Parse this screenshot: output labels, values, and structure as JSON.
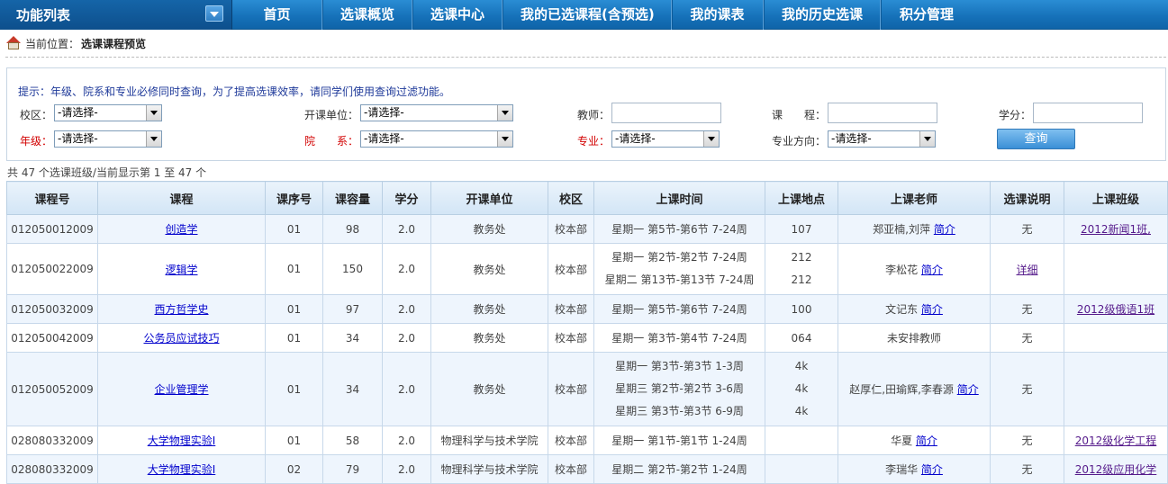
{
  "menu": {
    "title": "功能列表"
  },
  "nav": [
    "首页",
    "选课概览",
    "选课中心",
    "我的已选课程(含预选)",
    "我的课表",
    "我的历史选课",
    "积分管理"
  ],
  "breadcrumb": {
    "label": "当前位置：",
    "value": "选课课程预览"
  },
  "filter": {
    "hint": "提示：年级、院系和专业必修同时查询，为了提高选课效率，请同学们使用查询过滤功能。",
    "campus_label": "校区：",
    "campus_value": "-请选择-",
    "unit_label": "开课单位：",
    "unit_value": "-请选择-",
    "teacher_label": "教师：",
    "course_label": "课　　程：",
    "credit_label": "学分：",
    "grade_label": "年级：",
    "grade_value": "-请选择-",
    "dept_label": "院　　系：",
    "dept_value": "-请选择-",
    "major_label": "专业：",
    "major_value": "-请选择-",
    "direction_label": "专业方向：",
    "direction_value": "-请选择-",
    "query_button": "查询"
  },
  "summary": "共 47 个选课班级/当前显示第 1 至 47 个",
  "table": {
    "headers": [
      "课程号",
      "课程",
      "课序号",
      "课容量",
      "学分",
      "开课单位",
      "校区",
      "上课时间",
      "上课地点",
      "上课老师",
      "选课说明",
      "上课班级"
    ],
    "rows": [
      {
        "code": "012050012009",
        "course": "创造学",
        "seq": "01",
        "cap": "98",
        "credit": "2.0",
        "unit": "教务处",
        "campus": "校本部",
        "time": [
          "星期一 第5节-第6节 7-24周"
        ],
        "place": [
          "107"
        ],
        "teacher": "郑亚楠,刘萍",
        "teacher_link": "简介",
        "note": "无",
        "class": "2012新闻1班,"
      },
      {
        "code": "012050022009",
        "course": "逻辑学",
        "seq": "01",
        "cap": "150",
        "credit": "2.0",
        "unit": "教务处",
        "campus": "校本部",
        "time": [
          "星期一 第2节-第2节 7-24周",
          "星期二 第13节-第13节 7-24周"
        ],
        "place": [
          "212",
          "212"
        ],
        "teacher": "李松花",
        "teacher_link": "简介",
        "note": "详细",
        "class": ""
      },
      {
        "code": "012050032009",
        "course": "西方哲学史",
        "seq": "01",
        "cap": "97",
        "credit": "2.0",
        "unit": "教务处",
        "campus": "校本部",
        "time": [
          "星期一 第5节-第6节 7-24周"
        ],
        "place": [
          "100"
        ],
        "teacher": "文记东",
        "teacher_link": "简介",
        "note": "无",
        "class": "2012级俄语1班"
      },
      {
        "code": "012050042009",
        "course": "公务员应试技巧",
        "seq": "01",
        "cap": "34",
        "credit": "2.0",
        "unit": "教务处",
        "campus": "校本部",
        "time": [
          "星期一 第3节-第4节 7-24周"
        ],
        "place": [
          "064"
        ],
        "teacher": "未安排教师",
        "teacher_link": "",
        "note": "无",
        "class": ""
      },
      {
        "code": "012050052009",
        "course": "企业管理学",
        "seq": "01",
        "cap": "34",
        "credit": "2.0",
        "unit": "教务处",
        "campus": "校本部",
        "time": [
          "星期一 第3节-第3节 1-3周",
          "星期三 第2节-第2节 3-6周",
          "星期三 第3节-第3节 6-9周"
        ],
        "place": [
          "4k",
          "4k",
          "4k"
        ],
        "teacher": "赵厚仁,田瑜辉,李春源",
        "teacher_link": "简介",
        "note": "无",
        "class": ""
      },
      {
        "code": "028080332009",
        "course": "大学物理实验Ⅰ",
        "seq": "01",
        "cap": "58",
        "credit": "2.0",
        "unit": "物理科学与技术学院",
        "campus": "校本部",
        "time": [
          "星期一 第1节-第1节 1-24周"
        ],
        "place": [
          ""
        ],
        "teacher": "华夏",
        "teacher_link": "简介",
        "note": "无",
        "class": "2012级化学工程"
      },
      {
        "code": "028080332009",
        "course": "大学物理实验Ⅰ",
        "seq": "02",
        "cap": "79",
        "credit": "2.0",
        "unit": "物理科学与技术学院",
        "campus": "校本部",
        "time": [
          "星期二 第2节-第2节 1-24周"
        ],
        "place": [
          ""
        ],
        "teacher": "李瑞华",
        "teacher_link": "简介",
        "note": "无",
        "class": "2012级应用化学"
      }
    ]
  }
}
